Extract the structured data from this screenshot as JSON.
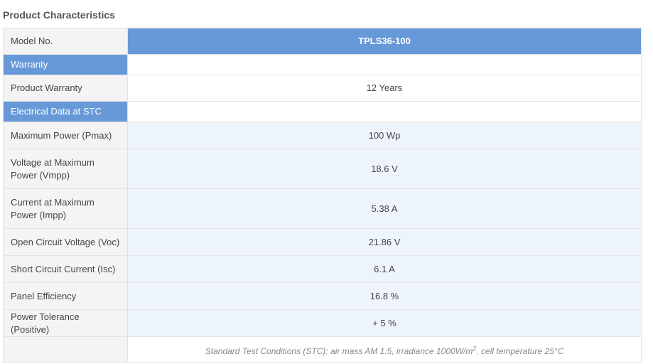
{
  "title": "Product Characteristics",
  "header": {
    "label": "Model No.",
    "value": "TPLS36-100"
  },
  "warranty_section": "Warranty",
  "warranty_row": {
    "label": "Product Warranty",
    "value": "12 Years"
  },
  "electrical_section": "Electrical Data at STC",
  "electrical_rows": [
    {
      "label": "Maximum Power (Pmax)",
      "value": "100 Wp"
    },
    {
      "label": "Voltage at Maximum Power (Vmpp)",
      "value": "18.6 V"
    },
    {
      "label": "Current at Maximum Power (Impp)",
      "value": "5.38 A"
    },
    {
      "label": "Open Circuit Voltage (Voc)",
      "value": "21.86 V"
    },
    {
      "label": "Short Circuit Current (Isc)",
      "value": "6.1 A"
    },
    {
      "label": "Panel Efficiency",
      "value": "16.8 %"
    },
    {
      "label": "Power Tolerance (Positive)",
      "value": "+ 5 %"
    }
  ],
  "note": {
    "prefix": "Standard Test Conditions (STC): air mass AM 1.5, irradiance 1000W/m",
    "superscript": "2",
    "suffix": ", cell temperature 25°C"
  }
}
